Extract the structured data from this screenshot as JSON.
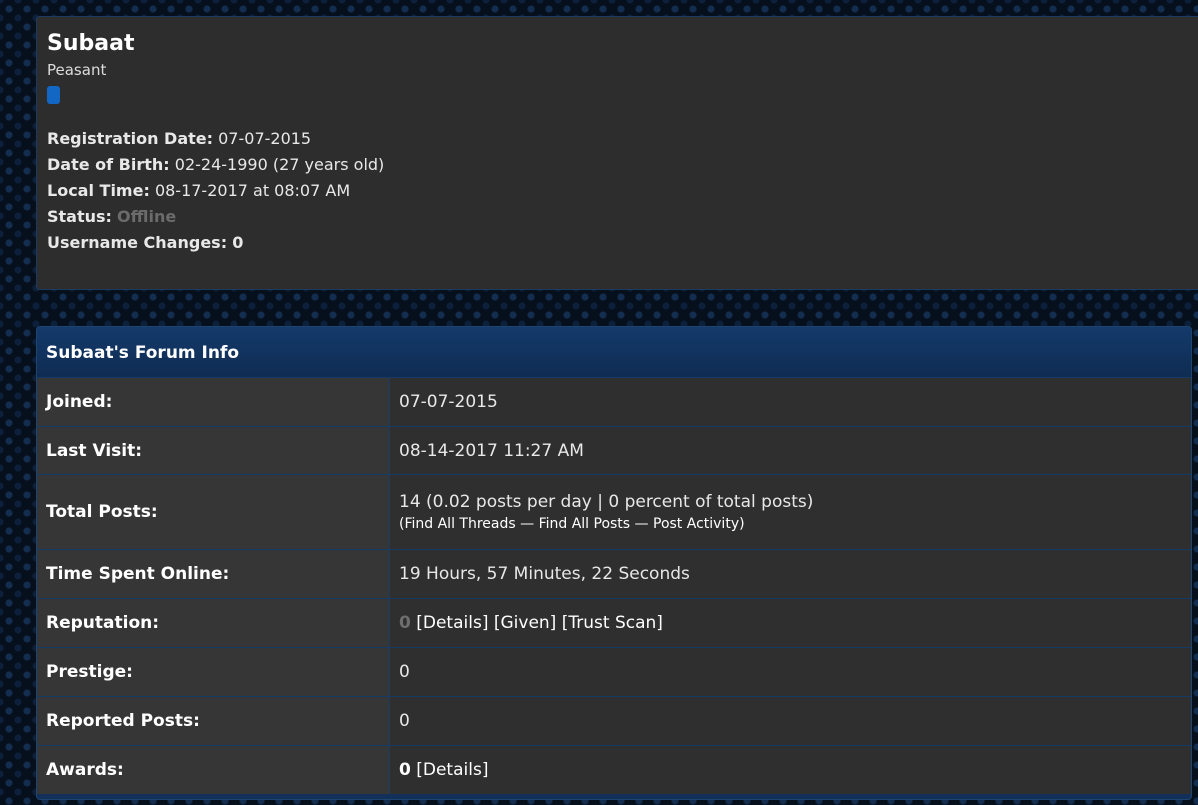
{
  "profile": {
    "username": "Subaat",
    "user_title": "Peasant",
    "rank_color": "#1266c4",
    "fields": {
      "registration_label": "Registration Date:",
      "registration_value": "07-07-2015",
      "dob_label": "Date of Birth:",
      "dob_value": "02-24-1990 (27 years old)",
      "local_time_label": "Local Time:",
      "local_time_value": "08-17-2017 at 08:07 AM",
      "status_label": "Status:",
      "status_value": "Offline",
      "username_changes_label": "Username Changes:",
      "username_changes_value": "0"
    }
  },
  "forum_info": {
    "title": "Subaat's Forum Info",
    "joined": {
      "label": "Joined:",
      "value": "07-07-2015"
    },
    "last_visit": {
      "label": "Last Visit:",
      "value": "08-14-2017 11:27 AM"
    },
    "total_posts": {
      "label": "Total Posts:",
      "value": "14 (0.02 posts per day | 0 percent of total posts)",
      "open_paren": "(",
      "find_threads": "Find All Threads",
      "sep1": " — ",
      "find_posts": "Find All Posts",
      "sep2": " — ",
      "post_activity": "Post Activity",
      "close_paren": ")"
    },
    "time_online": {
      "label": "Time Spent Online:",
      "value": "19 Hours, 57 Minutes, 22 Seconds"
    },
    "reputation": {
      "label": "Reputation:",
      "score": "0",
      "details": "[Details]",
      "given": "[Given]",
      "trust_scan": "[Trust Scan]"
    },
    "prestige": {
      "label": "Prestige:",
      "value": "0"
    },
    "reported_posts": {
      "label": "Reported Posts:",
      "value": "0"
    },
    "awards": {
      "label": "Awards:",
      "count": "0",
      "details": "[Details]"
    }
  },
  "colors": {
    "panel_bg": "#2d2d2d",
    "header_bg": "#143a6b",
    "offline": "#6b6b6b"
  }
}
